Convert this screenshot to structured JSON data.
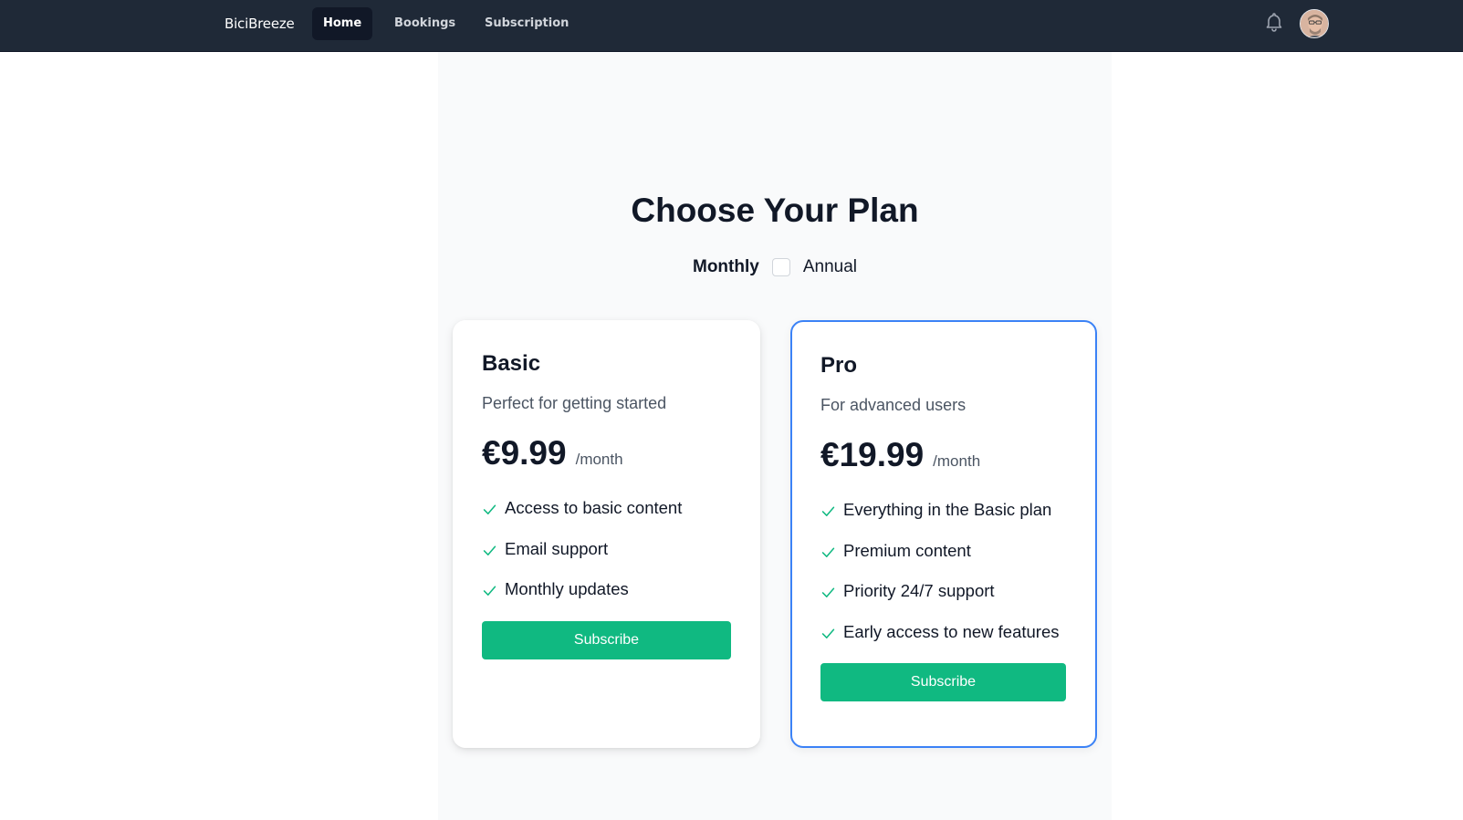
{
  "navbar": {
    "brand": "BiciBreeze",
    "links": [
      {
        "label": "Home",
        "active": true
      },
      {
        "label": "Bookings",
        "active": false
      },
      {
        "label": "Subscription",
        "active": false
      }
    ],
    "notification_icon": "bell-icon",
    "avatar_icon": "user-avatar"
  },
  "page": {
    "title": "Choose Your Plan",
    "billing": {
      "monthly_label": "Monthly",
      "annual_label": "Annual",
      "annual_checked": false
    }
  },
  "plans": [
    {
      "name": "Basic",
      "description": "Perfect for getting started",
      "price": "€9.99",
      "period": "/month",
      "features": [
        "Access to basic content",
        "Email support",
        "Monthly updates"
      ],
      "button_label": "Subscribe",
      "highlighted": false
    },
    {
      "name": "Pro",
      "description": "For advanced users",
      "price": "€19.99",
      "period": "/month",
      "features": [
        "Everything in the Basic plan",
        "Premium content",
        "Priority 24/7 support",
        "Early access to new features"
      ],
      "button_label": "Subscribe",
      "highlighted": true
    }
  ],
  "colors": {
    "nav_bg": "#1f2937",
    "accent_green": "#10b981",
    "highlight_border": "#3b82f6",
    "check_color": "#10b981"
  }
}
